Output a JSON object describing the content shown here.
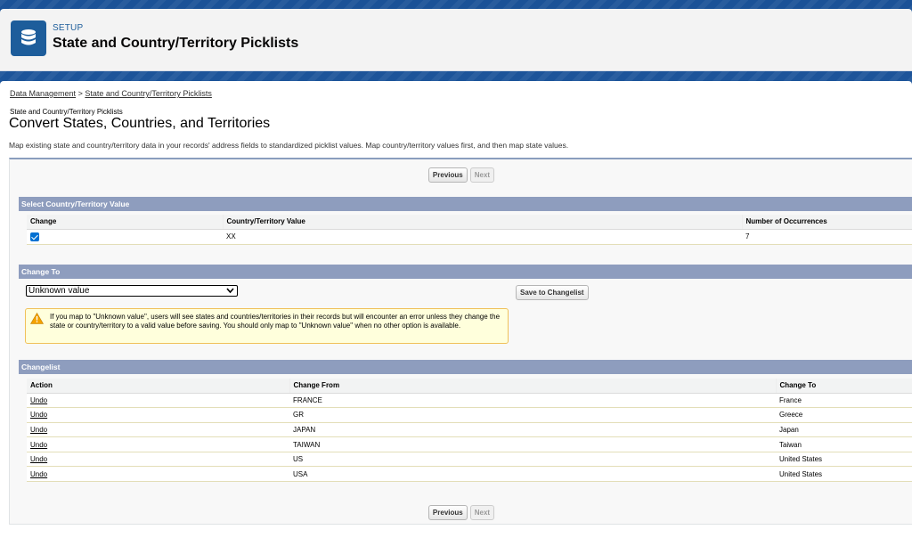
{
  "header": {
    "eyebrow": "SETUP",
    "title": "State and Country/Territory Picklists",
    "icon": "database-icon"
  },
  "breadcrumb": {
    "item1": "Data Management",
    "separator": ">",
    "item2": "State and Country/Territory Picklists"
  },
  "page": {
    "pre_title": "State and Country/Territory Picklists",
    "title": "Convert States, Countries, and Territories",
    "description": "Map existing state and country/territory data in your records' address fields to standardized picklist values. Map country/territory values first, and then map state values."
  },
  "nav": {
    "previous": "Previous",
    "next": "Next"
  },
  "select_section": {
    "title": "Select Country/Territory Value",
    "columns": [
      "Change",
      "Country/Territory Value",
      "Number of Occurrences"
    ],
    "row": {
      "checked": true,
      "value": "XX",
      "occurrences": "7"
    }
  },
  "change_to": {
    "title": "Change To",
    "selected": "Unknown value",
    "save_button": "Save to Changelist",
    "warning": "If you map to \"Unknown value\", users will see states and countries/territories in their records but will encounter an error unless they change the state or country/territory to a valid value before saving. You should only map to \"Unknown value\" when no other option is available."
  },
  "changelist": {
    "title": "Changelist",
    "columns": [
      "Action",
      "Change From",
      "Change To"
    ],
    "rows": [
      {
        "action": "Undo",
        "from": "FRANCE",
        "to": "France"
      },
      {
        "action": "Undo",
        "from": "GR",
        "to": "Greece"
      },
      {
        "action": "Undo",
        "from": "JAPAN",
        "to": "Japan"
      },
      {
        "action": "Undo",
        "from": "TAIWAN",
        "to": "Taiwan"
      },
      {
        "action": "Undo",
        "from": "US",
        "to": "United States"
      },
      {
        "action": "Undo",
        "from": "USA",
        "to": "United States"
      }
    ]
  },
  "colors": {
    "brand_blue": "#1b5297",
    "section_header": "#8e9dbe",
    "warning_bg": "#ffffdc",
    "checkbox": "#0070d2"
  }
}
